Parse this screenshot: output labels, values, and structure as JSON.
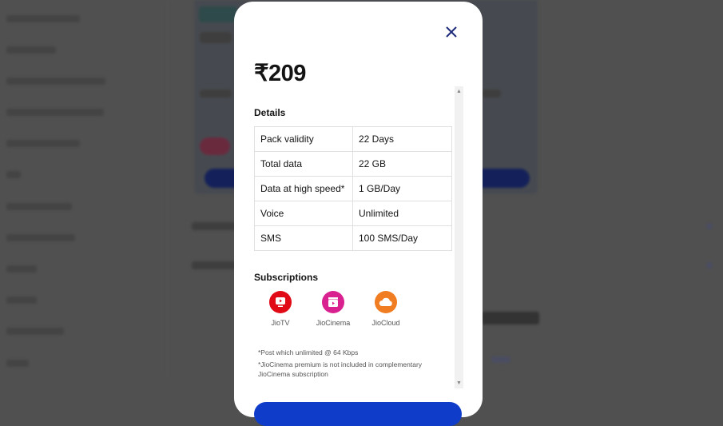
{
  "modal": {
    "price": "₹209",
    "details_heading": "Details",
    "details": [
      {
        "label": "Pack validity",
        "value": "22 Days"
      },
      {
        "label": "Total data",
        "value": "22 GB"
      },
      {
        "label": "Data at high speed*",
        "value": "1 GB/Day"
      },
      {
        "label": "Voice",
        "value": "Unlimited"
      },
      {
        "label": "SMS",
        "value": "100 SMS/Day"
      }
    ],
    "subscriptions_heading": "Subscriptions",
    "subscriptions": [
      {
        "name": "JioTV",
        "icon": "tv-icon",
        "color": "#e10a17"
      },
      {
        "name": "JioCinema",
        "icon": "clapperboard-icon",
        "color": "#d9218f"
      },
      {
        "name": "JioCloud",
        "icon": "cloud-icon",
        "color": "#f07d22"
      }
    ],
    "notes": [
      "*Post which unlimited @ 64 Kbps",
      "*JioCinema premium is not included in complementary JioCinema subscription"
    ]
  },
  "colors": {
    "accent": "#0f3cc9",
    "close": "#1e2a7a",
    "overlay": "#505050"
  }
}
